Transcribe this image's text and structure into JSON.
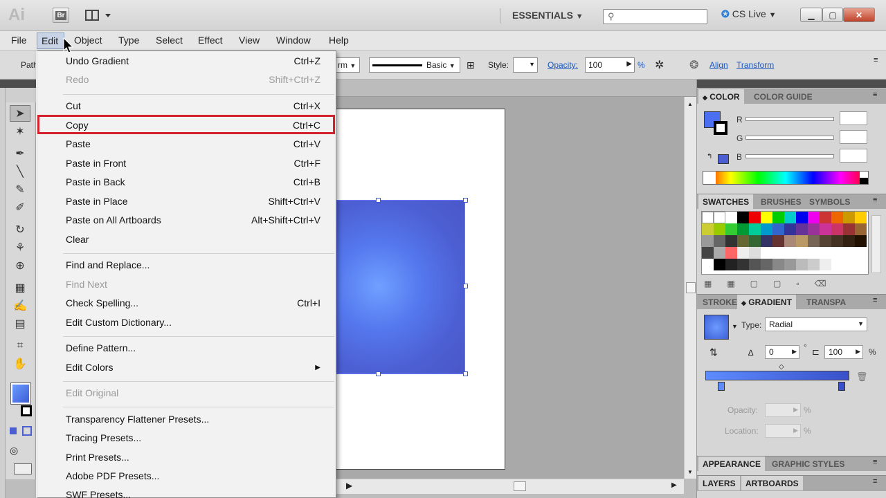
{
  "app": {
    "logo": "Ai",
    "bridge_label": "Br",
    "workspace": "ESSENTIALS",
    "cslive": "CS Live"
  },
  "menubar": {
    "items": [
      "File",
      "Edit",
      "Object",
      "Type",
      "Select",
      "Effect",
      "View",
      "Window",
      "Help"
    ]
  },
  "controlbar": {
    "path_label": "Path",
    "stroke_profile": "Basic",
    "style_label": "Style:",
    "opacity_label": "Opacity:",
    "opacity_value": "100",
    "opacity_unit": "%",
    "align_link": "Align",
    "transform_link": "Transform",
    "frm_text": "rm"
  },
  "edit_menu": {
    "items": [
      {
        "label": "Undo Gradient",
        "shortcut": "Ctrl+Z"
      },
      {
        "label": "Redo",
        "shortcut": "Shift+Ctrl+Z"
      },
      {
        "label": "Cut",
        "shortcut": "Ctrl+X"
      },
      {
        "label": "Copy",
        "shortcut": "Ctrl+C"
      },
      {
        "label": "Paste",
        "shortcut": "Ctrl+V"
      },
      {
        "label": "Paste in Front",
        "shortcut": "Ctrl+F"
      },
      {
        "label": "Paste in Back",
        "shortcut": "Ctrl+B"
      },
      {
        "label": "Paste in Place",
        "shortcut": "Shift+Ctrl+V"
      },
      {
        "label": "Paste on All Artboards",
        "shortcut": "Alt+Shift+Ctrl+V"
      },
      {
        "label": "Clear",
        "shortcut": ""
      },
      {
        "label": "Find and Replace...",
        "shortcut": ""
      },
      {
        "label": "Find Next",
        "shortcut": ""
      },
      {
        "label": "Check Spelling...",
        "shortcut": "Ctrl+I"
      },
      {
        "label": "Edit Custom Dictionary...",
        "shortcut": ""
      },
      {
        "label": "Define Pattern...",
        "shortcut": ""
      },
      {
        "label": "Edit Colors",
        "shortcut": ""
      },
      {
        "label": "Edit Original",
        "shortcut": ""
      },
      {
        "label": "Transparency Flattener Presets...",
        "shortcut": ""
      },
      {
        "label": "Tracing Presets...",
        "shortcut": ""
      },
      {
        "label": "Print Presets...",
        "shortcut": ""
      },
      {
        "label": "Adobe PDF Presets...",
        "shortcut": ""
      },
      {
        "label": "SWF Presets...",
        "shortcut": ""
      }
    ],
    "submenu_arrow": "▶"
  },
  "color_panel": {
    "tab_color": "COLOR",
    "tab_color_guide": "COLOR GUIDE",
    "r_label": "R",
    "g_label": "G",
    "b_label": "B"
  },
  "swatches_panel": {
    "tab_swatches": "SWATCHES",
    "tab_brushes": "BRUSHES",
    "tab_symbols": "SYMBOLS"
  },
  "gradient_panel": {
    "tab_stroke": "STROKE",
    "tab_gradient": "GRADIENT",
    "tab_transparency": "TRANSPA",
    "type_label": "Type:",
    "type_value": "Radial",
    "angle_value": "0",
    "degree": "°",
    "aspect_value": "100",
    "aspect_unit": "%",
    "opacity_label": "Opacity:",
    "opacity_unit": "%",
    "location_label": "Location:",
    "location_unit": "%"
  },
  "appearance_panel": {
    "tab_appearance": "APPEARANCE",
    "tab_graphic_styles": "GRAPHIC STYLES"
  },
  "layers_panel": {
    "tab_layers": "LAYERS",
    "tab_artboards": "ARTBOARDS"
  },
  "colors": {
    "highlight_red": "#d3202c",
    "link_blue": "#1a57c0",
    "fill_blue": "#4c5fd2"
  }
}
